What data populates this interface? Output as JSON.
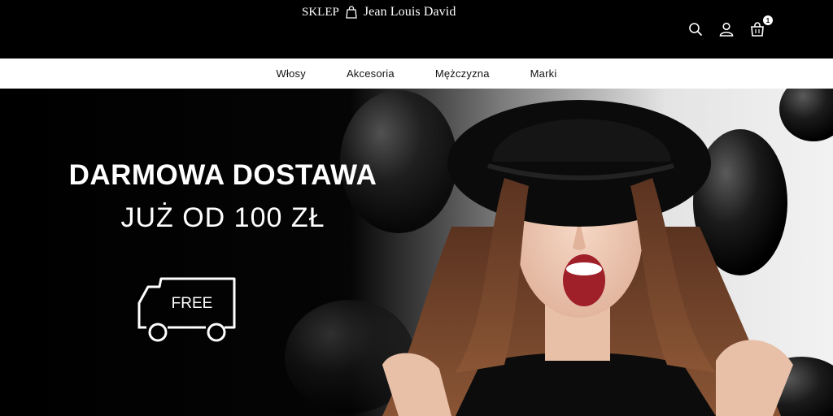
{
  "header": {
    "shop_label": "SKLEP",
    "brand": "Jean Louis David",
    "icons": [
      "search-icon",
      "user-icon",
      "cart-icon"
    ],
    "cart_count": "1"
  },
  "nav": {
    "items": [
      {
        "label": "Włosy"
      },
      {
        "label": "Akcesoria"
      },
      {
        "label": "Mężczyzna"
      },
      {
        "label": "Marki"
      }
    ]
  },
  "hero": {
    "headline": "DARMOWA DOSTAWA",
    "subline": "JUŻ OD 100 ZŁ",
    "badge_text": "FREE"
  },
  "colors": {
    "background": "#000000",
    "nav_background": "#ffffff",
    "text_light": "#ffffff",
    "text_dark": "#111111"
  }
}
